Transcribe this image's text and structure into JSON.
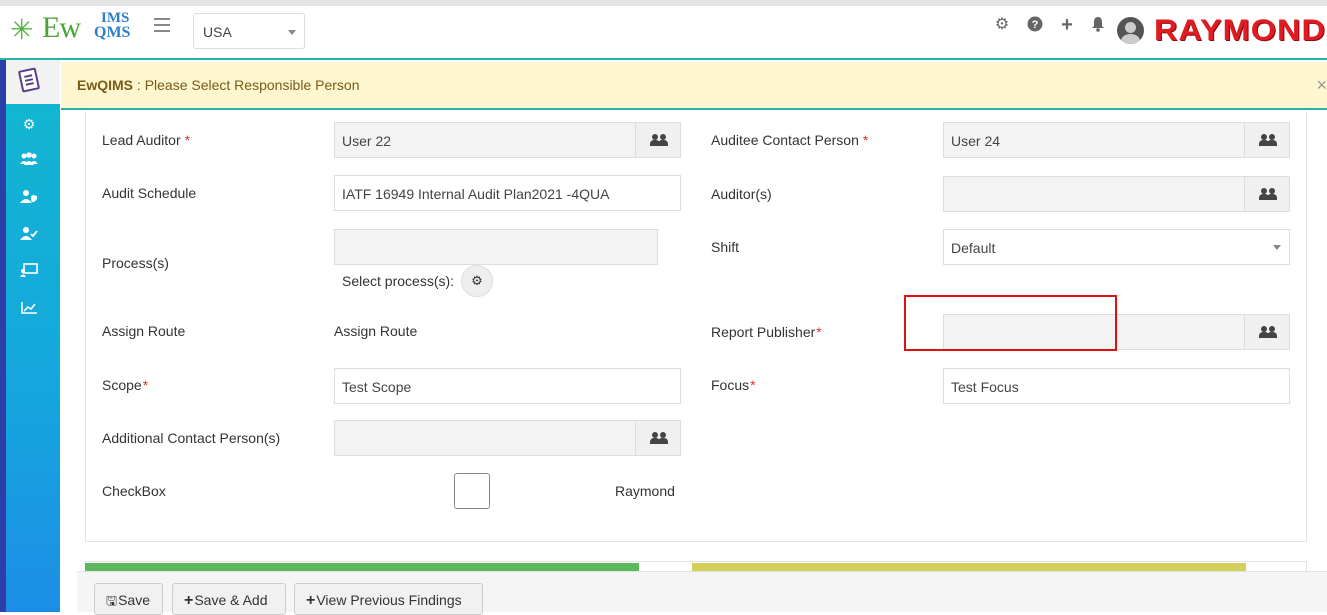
{
  "header": {
    "logo_ew": "Ew",
    "logo_ims": "IMS",
    "logo_qms": "QMS",
    "country": "USA",
    "brand": "RAYMOND",
    "icons": [
      "gear-icon",
      "help-icon",
      "plus-icon",
      "bell-icon",
      "user-avatar"
    ]
  },
  "sidebar": {
    "icons": [
      "document-icon",
      "settings-icon",
      "users-group-icon",
      "user-shield-icon",
      "user-check-icon",
      "presentation-icon",
      "chart-line-icon"
    ]
  },
  "alert": {
    "app": "EwQIMS",
    "separator": " : ",
    "message": "Please Select Responsible Person",
    "close": "×"
  },
  "form": {
    "lead_auditor": {
      "label": "Lead Auditor",
      "required": "*",
      "value": "User 22"
    },
    "auditee_contact": {
      "label": "Auditee Contact Person",
      "required": "*",
      "value": "User 24"
    },
    "audit_schedule": {
      "label": "Audit Schedule",
      "value": "IATF 16949 Internal Audit Plan2021 -4QUA"
    },
    "auditors": {
      "label": "Auditor(s)",
      "value": ""
    },
    "processes": {
      "label": "Process(s)",
      "value": "",
      "select_label": "Select process(s):"
    },
    "shift": {
      "label": "Shift",
      "value": "Default"
    },
    "assign_route": {
      "label": "Assign Route",
      "value": "Assign Route"
    },
    "report_publisher": {
      "label": "Report Publisher",
      "required": "*",
      "value": ""
    },
    "scope": {
      "label": "Scope",
      "required": "*",
      "value": "Test Scope"
    },
    "focus": {
      "label": "Focus",
      "required": "*",
      "value": "Test Focus"
    },
    "additional_contact": {
      "label": "Additional Contact Person(s)",
      "value": ""
    },
    "checkbox": {
      "label": "CheckBox",
      "checked": false,
      "option_label": "Raymond"
    }
  },
  "buttons": {
    "save": "Save",
    "save_add": "Save & Add",
    "view_previous": "View Previous Findings"
  },
  "colors": {
    "alert_bg": "#fdf6cf",
    "accent_teal": "#25b4a8",
    "required": "#e0302a",
    "brand_red": "#e11b22",
    "progress_green": "#5cb85c",
    "progress_yellow": "#d4cf5a"
  }
}
